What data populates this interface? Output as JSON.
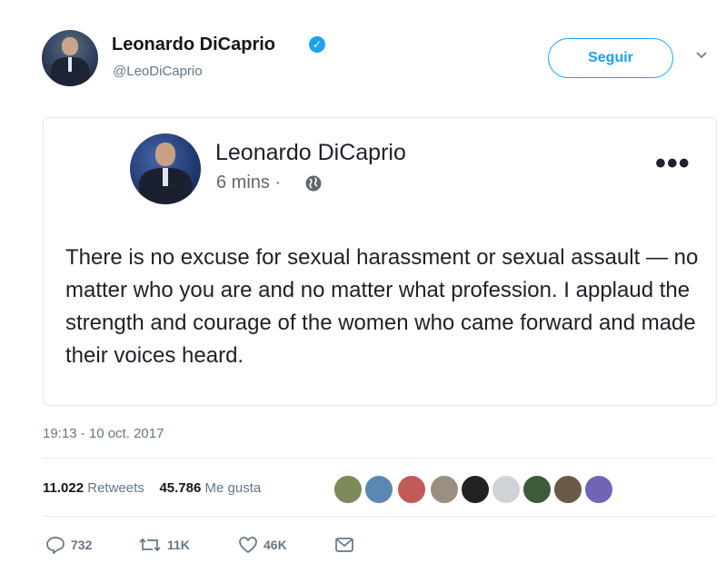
{
  "tweet": {
    "author_name": "Leonardo DiCaprio",
    "verified_badge_icon": "verified-check-icon",
    "handle": "@LeoDiCaprio",
    "follow_label": "Seguir",
    "menu_icon": "chevron-down-icon",
    "timestamp": "19:13 - 10 oct. 2017",
    "retweets_count": "11.022",
    "retweets_label": "Retweets",
    "likes_count": "45.786",
    "likes_label": "Me gusta",
    "actions": {
      "reply_count": "732",
      "retweet_count": "11K",
      "like_count": "46K"
    }
  },
  "embedded_post": {
    "author_name": "Leonardo DiCaprio",
    "time": "6 mins ·",
    "text": "There is no excuse for sexual harassment or sexual assault — no matter who you are and no matter what profession. I applaud the strength and courage of the women who came forward and made their voices heard.",
    "more_icon": "ellipsis-icon",
    "privacy_icon": "globe-icon"
  },
  "colors": {
    "accent": "#1da1f2",
    "muted": "#657786",
    "text": "#14171a"
  }
}
